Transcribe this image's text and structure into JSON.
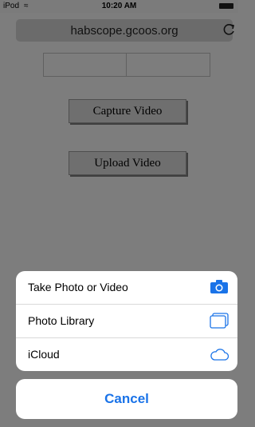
{
  "status_bar": {
    "carrier": "iPod",
    "time": "10:20 AM"
  },
  "browser": {
    "url": "habscope.gcoos.org",
    "reload_icon": "reload-icon"
  },
  "page": {
    "capture_label": "Capture Video",
    "upload_label": "Upload Video"
  },
  "action_sheet": {
    "items": [
      {
        "label": "Take Photo or Video",
        "icon": "camera-icon"
      },
      {
        "label": "Photo Library",
        "icon": "photo-library-icon"
      },
      {
        "label": "iCloud",
        "icon": "cloud-icon"
      }
    ],
    "cancel_label": "Cancel"
  },
  "colors": {
    "accent": "#1a73e8",
    "dim_overlay": "#7d7d7d"
  }
}
